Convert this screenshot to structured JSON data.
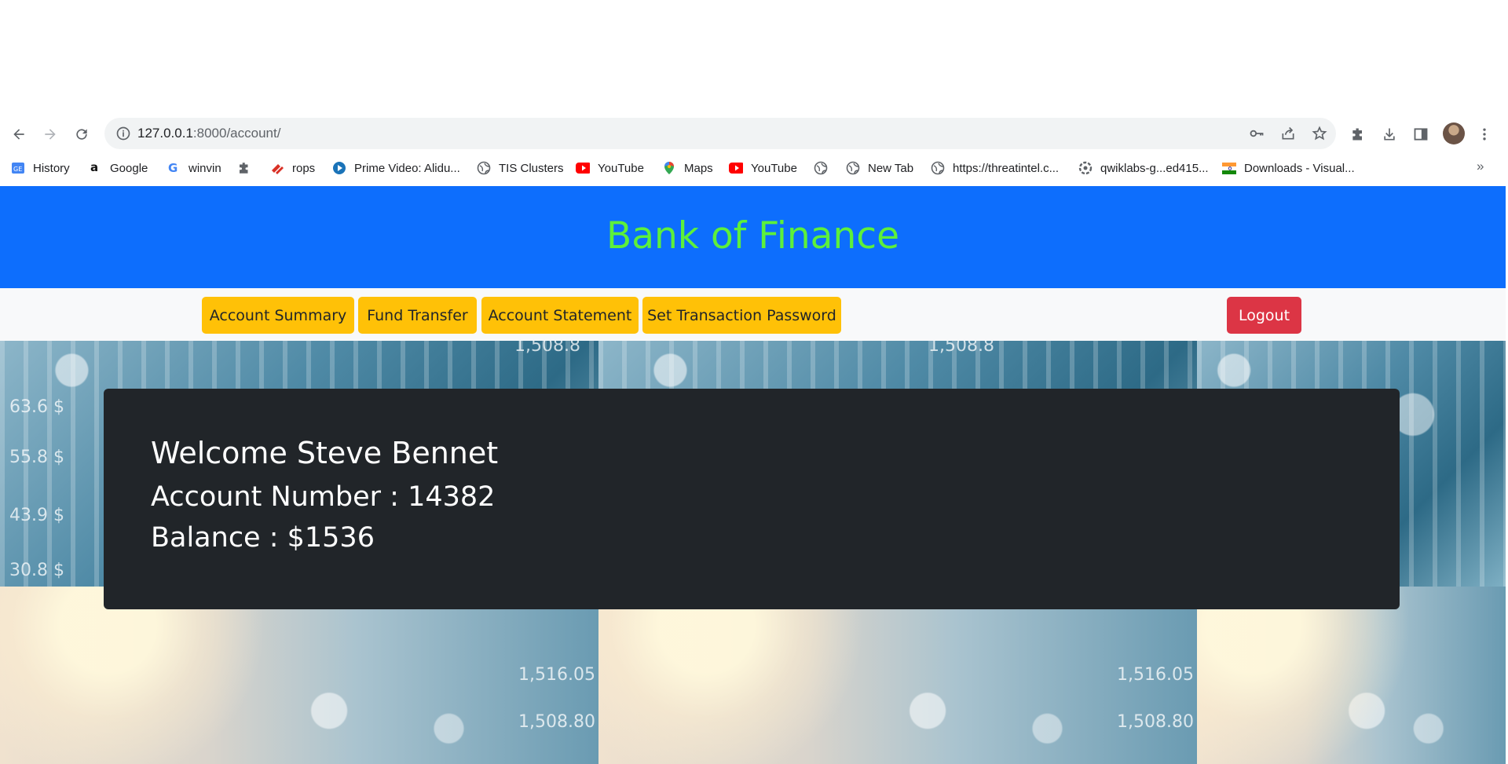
{
  "browser": {
    "url_host": "127.0.0.1",
    "url_rest": ":8000/account/",
    "bookmarks": [
      {
        "label": "History",
        "icon": "history-icon"
      },
      {
        "label": "Google",
        "icon": "amazon-icon"
      },
      {
        "label": "winvin",
        "icon": "google-icon"
      },
      {
        "label": "",
        "icon": "extension-icon"
      },
      {
        "label": "rops",
        "icon": "rops-icon"
      },
      {
        "label": "Prime Video: Alidu...",
        "icon": "prime-video-icon"
      },
      {
        "label": "TIS Clusters",
        "icon": "globe-icon"
      },
      {
        "label": "YouTube",
        "icon": "youtube-icon"
      },
      {
        "label": "Maps",
        "icon": "maps-icon"
      },
      {
        "label": "YouTube",
        "icon": "youtube-icon"
      },
      {
        "label": "",
        "icon": "globe-icon"
      },
      {
        "label": "New Tab",
        "icon": "globe-icon"
      },
      {
        "label": "https://threatintel.c...",
        "icon": "globe-icon"
      },
      {
        "label": "qwiklabs-g...ed415...",
        "icon": "qwiklabs-icon"
      },
      {
        "label": "Downloads - Visual...",
        "icon": "india-flag-icon"
      }
    ],
    "more_label": "»"
  },
  "site": {
    "brand": "Bank of Finance",
    "brand_color": "#5df03b",
    "header_color": "#0d6efd"
  },
  "nav": {
    "account_summary": "Account Summary",
    "fund_transfer": "Fund Transfer",
    "account_statement": "Account Statement",
    "set_transaction_password": "Set Transaction Password",
    "logout": "Logout"
  },
  "account": {
    "welcome": "Welcome Steve Bennet",
    "account_number": "Account Number : 14382",
    "balance": "Balance : $1536"
  },
  "background_labels": {
    "top_a": "63.6 $",
    "top_b": "55.8 $",
    "top_c": "43.9 $",
    "top_d": "30.8 $",
    "top_e": "1,508.8",
    "bottom_a": "1,516.05",
    "bottom_b": "1,508.80"
  }
}
